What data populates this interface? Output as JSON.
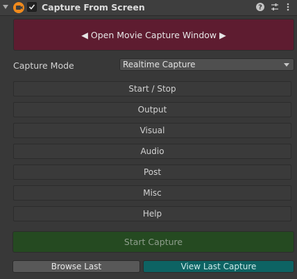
{
  "header": {
    "title": "Capture From Screen",
    "enabled": true,
    "icons": [
      "foldout-arrow-icon",
      "capture-component-icon",
      "help-icon",
      "preset-icon",
      "more-icon"
    ]
  },
  "open_window": {
    "label": "◀ Open Movie Capture Window ▶"
  },
  "capture_mode": {
    "label": "Capture Mode",
    "selected": "Realtime Capture"
  },
  "sections": [
    {
      "label": "Start / Stop"
    },
    {
      "label": "Output"
    },
    {
      "label": "Visual"
    },
    {
      "label": "Audio"
    },
    {
      "label": "Post"
    },
    {
      "label": "Misc"
    },
    {
      "label": "Help"
    }
  ],
  "actions": {
    "start_capture": "Start Capture",
    "browse_last": "Browse Last",
    "view_last_capture": "View Last Capture"
  },
  "colors": {
    "background": "#383838",
    "open_window": "#5e1c30",
    "start_capture": "#254a21",
    "view_last": "#0d6363",
    "browse_last": "#585858",
    "icon_orange": "#f08a1c"
  }
}
